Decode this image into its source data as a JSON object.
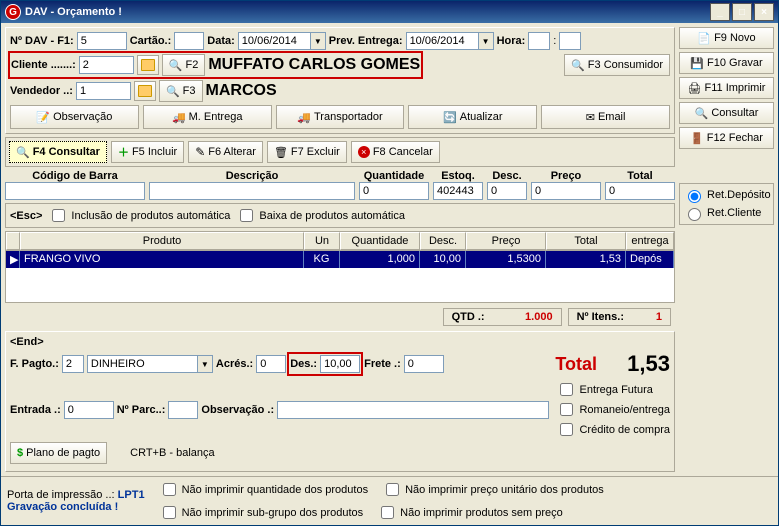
{
  "titlebar": {
    "title": "DAV - Orçamento !"
  },
  "header": {
    "lbl_dav": "Nº DAV - F1:",
    "dav_val": "5",
    "lbl_cartao": "Cartão.:",
    "cartao_val": "",
    "lbl_data": "Data:",
    "data_val": "10/06/2014",
    "lbl_prev": "Prev. Entrega:",
    "prev_val": "10/06/2014",
    "lbl_hora": "Hora:",
    "hora_h": "",
    "hora_m": "",
    "lbl_cliente": "Cliente .......:",
    "cliente_val": "2",
    "f2_btn": "F2",
    "cliente_nome": "MUFFATO CARLOS GOMES",
    "f3_cons": "F3 Consumidor",
    "lbl_vend": "Vendedor ..:",
    "vend_val": "1",
    "f3_btn": "F3",
    "vend_nome": "MARCOS"
  },
  "toolbar": {
    "obs": "Observação",
    "ment": "M. Entrega",
    "transp": "Transportador",
    "atual": "Atualizar",
    "email": "Email"
  },
  "actionbar": {
    "f4": "F4 Consultar",
    "f5": "F5 Incluir",
    "f6": "F6 Alterar",
    "f7": "F7 Excluir",
    "f8": "F8 Cancelar"
  },
  "side": {
    "f9": "F9 Novo",
    "f10": "F10 Gravar",
    "f11": "F11 Imprimir",
    "consultar": "Consultar",
    "f12": "F12 Fechar"
  },
  "radiogroup": {
    "ret_dep": "Ret.Depósito",
    "ret_cli": "Ret.Cliente"
  },
  "cols": {
    "codigo": "Código de Barra",
    "desc": "Descrição",
    "quant": "Quantidade",
    "estoq": "Estoq.",
    "desc_p": "Desc.",
    "preco": "Preço",
    "total": "Total"
  },
  "colvals": {
    "codigo": "",
    "desc": "",
    "quant": "0",
    "estoq": "402443",
    "desc_p": "0",
    "preco": "0",
    "total": "0"
  },
  "escbar": {
    "esc": "<Esc>",
    "inc": "Inclusão de produtos automática",
    "baixa": "Baixa de produtos automática"
  },
  "gridhdr": {
    "produto": "Produto",
    "un": "Un",
    "quant": "Quantidade",
    "desc": "Desc.",
    "preco": "Preço",
    "total": "Total",
    "entrega": "entrega"
  },
  "gridrows": [
    {
      "produto": "FRANGO VIVO",
      "un": "KG",
      "quant": "1,000",
      "desc": "10,00",
      "preco": "1,5300",
      "total": "1,53",
      "entrega": "Depós"
    }
  ],
  "qtdbar": {
    "qtd_lbl": "QTD .:",
    "qtd_val": "1.000",
    "itens_lbl": "Nº Itens.:",
    "itens_val": "1"
  },
  "footer": {
    "end": "<End>",
    "fpagto_lbl": "F. Pagto.:",
    "fpagto_val": "2",
    "fpagto_sel": "DINHEIRO",
    "acres_lbl": "Acrés.:",
    "acres_val": "0",
    "des_lbl": "Des.:",
    "des_val": "10,00",
    "frete_lbl": "Frete .:",
    "frete_val": "0",
    "total_lbl": "Total",
    "total_val": "1,53",
    "entrada_lbl": "Entrada .:",
    "entrada_val": "0",
    "nparc_lbl": "Nº Parc..:",
    "nparc_val": "",
    "obs_lbl": "Observação .:",
    "obs_val": "",
    "plano": "Plano de pagto",
    "crtb": "CRT+B - balança",
    "ent_fut": "Entrega Futura",
    "rom": "Romaneio/entrega",
    "cred": "Crédito de compra"
  },
  "status": {
    "porta_lbl": "Porta de impressão ..:",
    "porta_val": "LPT1",
    "grav": "Gravação concluída !",
    "noprint_qtd": "Não imprimir quantidade dos produtos",
    "noprint_sub": "Não imprimir sub-grupo dos produtos",
    "noprint_preco": "Não imprimir preço unitário dos produtos",
    "noprint_sempreco": "Não imprimir produtos sem preço"
  }
}
